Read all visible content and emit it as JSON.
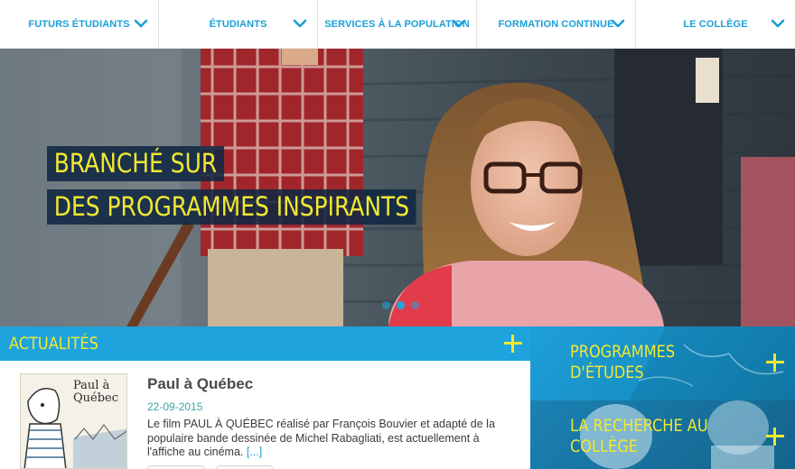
{
  "nav": {
    "items": [
      {
        "label": "FUTURS ÉTUDIANTS"
      },
      {
        "label": "ÉTUDIANTS"
      },
      {
        "label": "SERVICES À LA POPULATION"
      },
      {
        "label": "FORMATION CONTINUE"
      },
      {
        "label": "LE COLLÈGE"
      }
    ]
  },
  "hero": {
    "line1": "BRANCHÉ SUR",
    "line2": "DES PROGRAMMES INSPIRANTS",
    "slides": 3,
    "active_slide": 2
  },
  "news": {
    "header": "ACTUALITÉS",
    "article": {
      "thumb_text_line1": "Paul à",
      "thumb_text_line2": "Québec",
      "title": "Paul à Québec",
      "date": "22-09-2015",
      "text": "Le film PAUL À QUÉBEC réalisé par François Bouvier et adapté de la populaire bande dessinée de Michel Rabagliati, est actuellement à l'affiche au cinéma.",
      "more": "[...]"
    }
  },
  "tiles": [
    {
      "label_line1": "PROGRAMMES",
      "label_line2": "D'ÉTUDES"
    },
    {
      "label_line1": "LA RECHERCHE AU",
      "label_line2": "COLLÈGE"
    }
  ],
  "colors": {
    "brand_blue": "#1ea3dc",
    "accent_yellow": "#f2e832",
    "navy": "#102842"
  }
}
